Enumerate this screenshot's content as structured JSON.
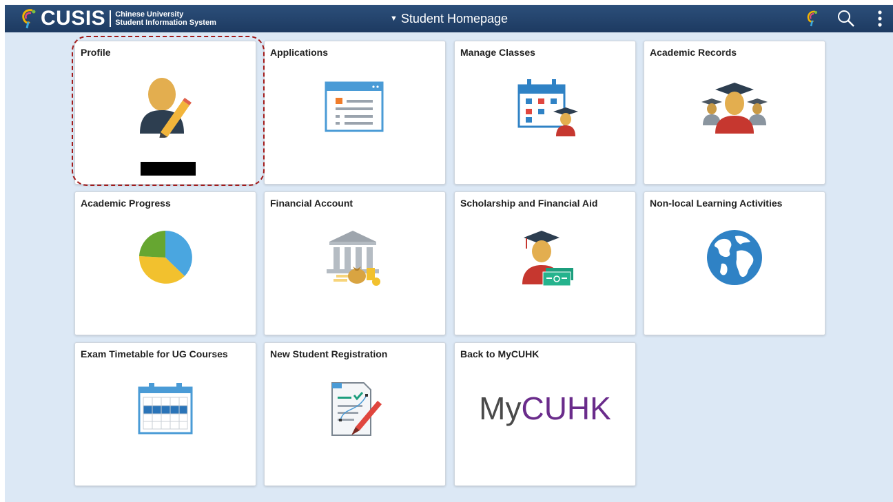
{
  "header": {
    "logo_word": "CUSIS",
    "logo_sub_line1": "Chinese University",
    "logo_sub_line2": "Student Information System",
    "page_title": "Student Homepage",
    "actions": [
      {
        "name": "navbar-icon"
      },
      {
        "name": "search-icon"
      },
      {
        "name": "actions-menu-icon"
      }
    ]
  },
  "tiles": [
    {
      "label": "Profile",
      "icon": "profile-icon"
    },
    {
      "label": "Applications",
      "icon": "applications-icon"
    },
    {
      "label": "Manage Classes",
      "icon": "manage-classes-icon"
    },
    {
      "label": "Academic Records",
      "icon": "academic-records-icon"
    },
    {
      "label": "Academic Progress",
      "icon": "pie-chart-icon"
    },
    {
      "label": "Financial Account",
      "icon": "bank-icon"
    },
    {
      "label": "Scholarship and Financial Aid",
      "icon": "scholarship-icon"
    },
    {
      "label": "Non-local Learning Activities",
      "icon": "globe-icon"
    },
    {
      "label": "Exam Timetable for UG Courses",
      "icon": "calendar-icon"
    },
    {
      "label": "New Student Registration",
      "icon": "registration-form-icon"
    },
    {
      "label": "Back to MyCUHK",
      "icon": "mycuhk-logo"
    }
  ],
  "mycuhk_logo": {
    "my": "My",
    "cuhk": "CUHK"
  },
  "colors": {
    "header": "#1d3a61",
    "background": "#dce8f5",
    "focus": "#a21b1b"
  }
}
